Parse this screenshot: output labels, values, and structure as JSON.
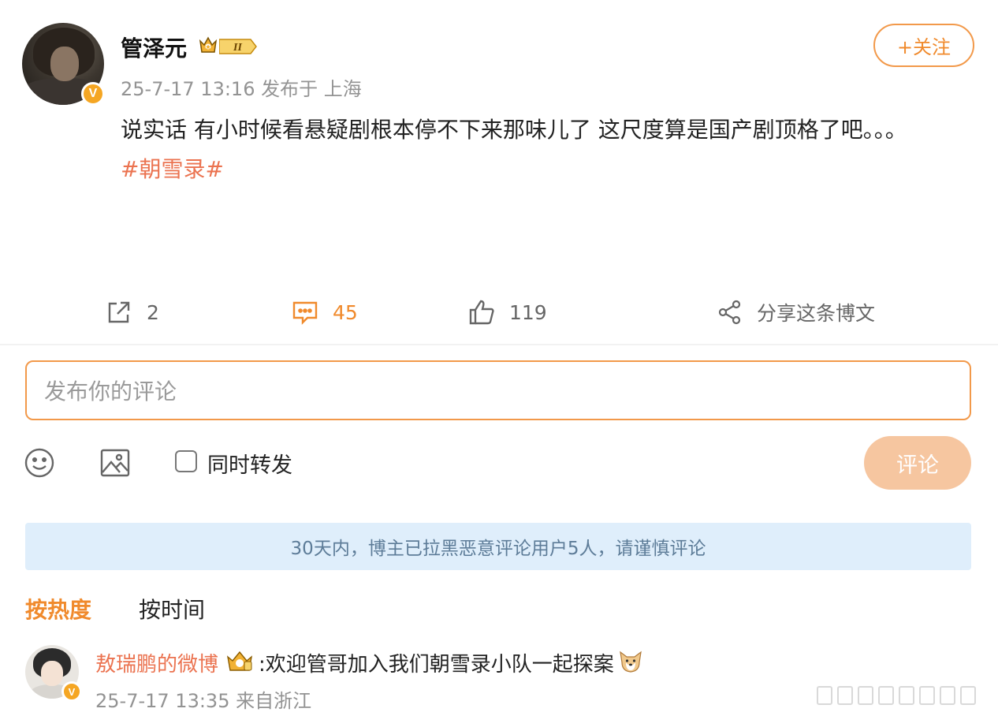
{
  "post": {
    "username": "管泽元",
    "level_badge": "II",
    "meta": "25-7-17 13:16 发布于 上海",
    "follow_label": "+关注",
    "text_main": "说实话 有小时候看悬疑剧根本停不下来那味儿了  这尺度算是国产剧顶格了吧。。。",
    "topic": "#朝雪录#",
    "verified_icon": "v-badge-icon"
  },
  "actions": {
    "repost_count": "2",
    "comment_count": "45",
    "like_count": "119",
    "share_label": "分享这条博文"
  },
  "composer": {
    "placeholder": "发布你的评论",
    "repost_label": "同时转发",
    "submit_label": "评论"
  },
  "notice": "30天内，博主已拉黑恶意评论用户5人，请谨慎评论",
  "sort": {
    "hot": "按热度",
    "time": "按时间"
  },
  "comments": [
    {
      "name": "敖瑞鹏的微博",
      "text": ":欢迎管哥加入我们朝雪录小队一起探案",
      "meta": "25-7-17 13:35 来自浙江"
    }
  ],
  "colors": {
    "accent": "#f08a2c",
    "topic": "#eb7350",
    "notice_bg": "#dfeefb",
    "submit_disabled": "#f6c6a0"
  }
}
